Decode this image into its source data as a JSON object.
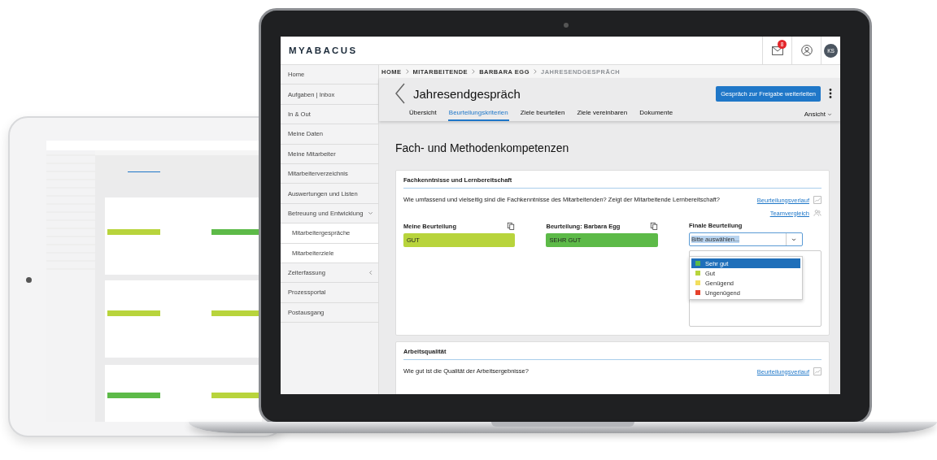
{
  "laptop": {
    "logo": "MYABACUS",
    "header": {
      "notifications": "8",
      "avatar": "KS"
    },
    "sidebar": [
      {
        "label": "Home",
        "kind": "link"
      },
      {
        "label": "Aufgaben | Inbox",
        "kind": "link"
      },
      {
        "label": "In & Out",
        "kind": "link"
      },
      {
        "label": "Meine Daten",
        "kind": "link"
      },
      {
        "label": "Meine Mitarbeiter",
        "kind": "link"
      },
      {
        "label": "Mitarbeiterverzeichnis",
        "kind": "link"
      },
      {
        "label": "Auswertungen und Listen",
        "kind": "link"
      },
      {
        "label": "Betreuung und Entwicklung",
        "kind": "group",
        "expanded": true,
        "children": [
          {
            "label": "Mitarbeitergespräche"
          },
          {
            "label": "Mitarbeiterziele"
          }
        ]
      },
      {
        "label": "Zeiterfassung",
        "kind": "group",
        "expanded": false
      },
      {
        "label": "Prozessportal",
        "kind": "link"
      },
      {
        "label": "Postausgang",
        "kind": "link"
      }
    ],
    "breadcrumb": [
      {
        "label": "HOME",
        "current": false
      },
      {
        "label": "MITARBEITENDE",
        "current": false
      },
      {
        "label": "BARBARA EGG",
        "current": false
      },
      {
        "label": "JAHRESENDGESPRÄCH",
        "current": true
      }
    ],
    "page": {
      "title": "Jahresendgespräch",
      "primary_button": "Gespräch zur Freigabe weiterleiten",
      "tabs": [
        {
          "label": "Übersicht",
          "selected": false
        },
        {
          "label": "Beurteilungskriterien",
          "selected": true
        },
        {
          "label": "Ziele beurteilen",
          "selected": false
        },
        {
          "label": "Ziele vereinbaren",
          "selected": false
        },
        {
          "label": "Dokumente",
          "selected": false
        }
      ],
      "view_menu": "Ansicht",
      "section_title": "Fach- und Methodenkompetenzen",
      "cards": [
        {
          "title": "Fachkenntnisse und Lernbereitschaft",
          "question": "Wie umfassend und vielseitig sind die Fachkenntnisse des Mitarbeitenden? Zeigt der Mitarbeitende Lernbereitschaft?",
          "links": [
            {
              "label": "Beurteilungsverlauf",
              "kind": "history"
            },
            {
              "label": "Teamvergleich",
              "kind": "team"
            }
          ],
          "ratings": [
            {
              "label": "Meine Beurteilung",
              "value": "GUT",
              "color": "#b8d43c"
            },
            {
              "label": "Beurteilung: Barbara Egg",
              "value": "SEHR GUT",
              "color": "#5dba48"
            }
          ],
          "final": {
            "label": "Finale Beurteilung",
            "value": "Bitte auswählen...",
            "expanded": true,
            "options": [
              {
                "label": "Sehr gut",
                "color": "#5dba48",
                "selected": true
              },
              {
                "label": "Gut",
                "color": "#b8d43c",
                "selected": false
              },
              {
                "label": "Genügend",
                "color": "#f2df5e",
                "selected": false
              },
              {
                "label": "Ungenügend",
                "color": "#e6412b",
                "selected": false
              }
            ]
          }
        },
        {
          "title": "Arbeitsqualität",
          "question": "Wie gut ist die Qualität der Arbeitsergebnisse?",
          "links": [
            {
              "label": "Beurteilungsverlauf",
              "kind": "history"
            }
          ]
        }
      ]
    }
  }
}
